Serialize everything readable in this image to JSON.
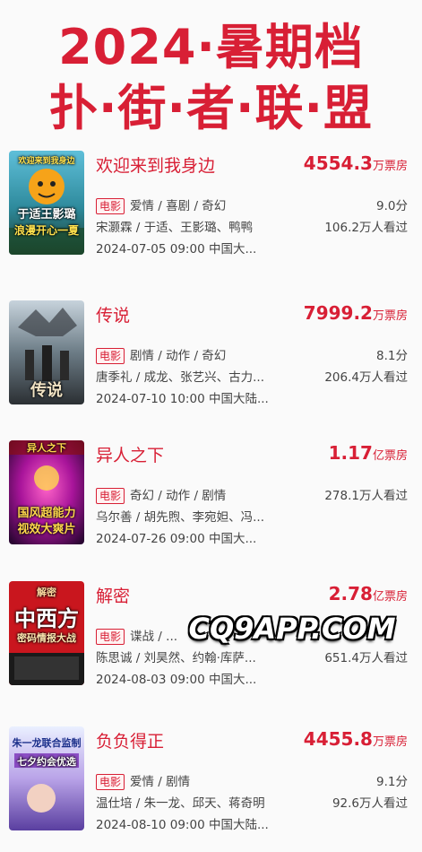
{
  "colors": {
    "brand": "#d81f35"
  },
  "header": {
    "line1": "2024·暑期档",
    "line2": "扑·街·者·联·盟"
  },
  "movies": [
    {
      "title": "欢迎来到我身边",
      "box": "4554.3",
      "box_unit": "万票房",
      "tag": "电影",
      "genres": "爱情 / 喜剧 / 奇幻",
      "rating": "9.0分",
      "cast": "宋灏霖 / 于适、王影璐、鸭鸭",
      "viewers": "106.2万人看过",
      "release": "2024-07-05 09:00 中国大...",
      "poster_text": [
        "欢迎来到我身边",
        "于适王影璐",
        "浪漫开心一夏"
      ]
    },
    {
      "title": "传说",
      "box": "7999.2",
      "box_unit": "万票房",
      "tag": "电影",
      "genres": "剧情 / 动作 / 奇幻",
      "rating": "8.1分",
      "cast": "唐季礼 / 成龙、张艺兴、古力...",
      "viewers": "206.4万人看过",
      "release": "2024-07-10 10:00 中国大陆...",
      "poster_text": [
        "传说"
      ]
    },
    {
      "title": "异人之下",
      "box": "1.17",
      "box_unit": "亿票房",
      "tag": "电影",
      "genres": "奇幻 / 动作 / 剧情",
      "rating": "",
      "cast": "乌尔善 / 胡先煦、李宛妲、冯...",
      "viewers": "278.1万人看过",
      "release": "2024-07-26 09:00 中国大...",
      "poster_text": [
        "异人之下",
        "国风超能力",
        "视效大爽片"
      ]
    },
    {
      "title": "解密",
      "box": "2.78",
      "box_unit": "亿票房",
      "tag": "电影",
      "genres": "谍战 / ...",
      "rating": "",
      "cast": "陈思诚 / 刘昊然、约翰·库萨...",
      "viewers": "651.4万人看过",
      "release": "2024-08-03 09:00 中国大...",
      "poster_text": [
        "解密",
        "中西方",
        "密码情报大战"
      ]
    },
    {
      "title": "负负得正",
      "box": "4455.8",
      "box_unit": "万票房",
      "tag": "电影",
      "genres": "爱情 / 剧情",
      "rating": "9.1分",
      "cast": "温仕培 / 朱一龙、邱天、蒋奇明",
      "viewers": "92.6万人看过",
      "release": "2024-08-10 09:00 中国大陆...",
      "poster_text": [
        "朱一龙联合监制",
        "七夕约会优选"
      ]
    }
  ],
  "watermark": "CQ9APP.COM"
}
